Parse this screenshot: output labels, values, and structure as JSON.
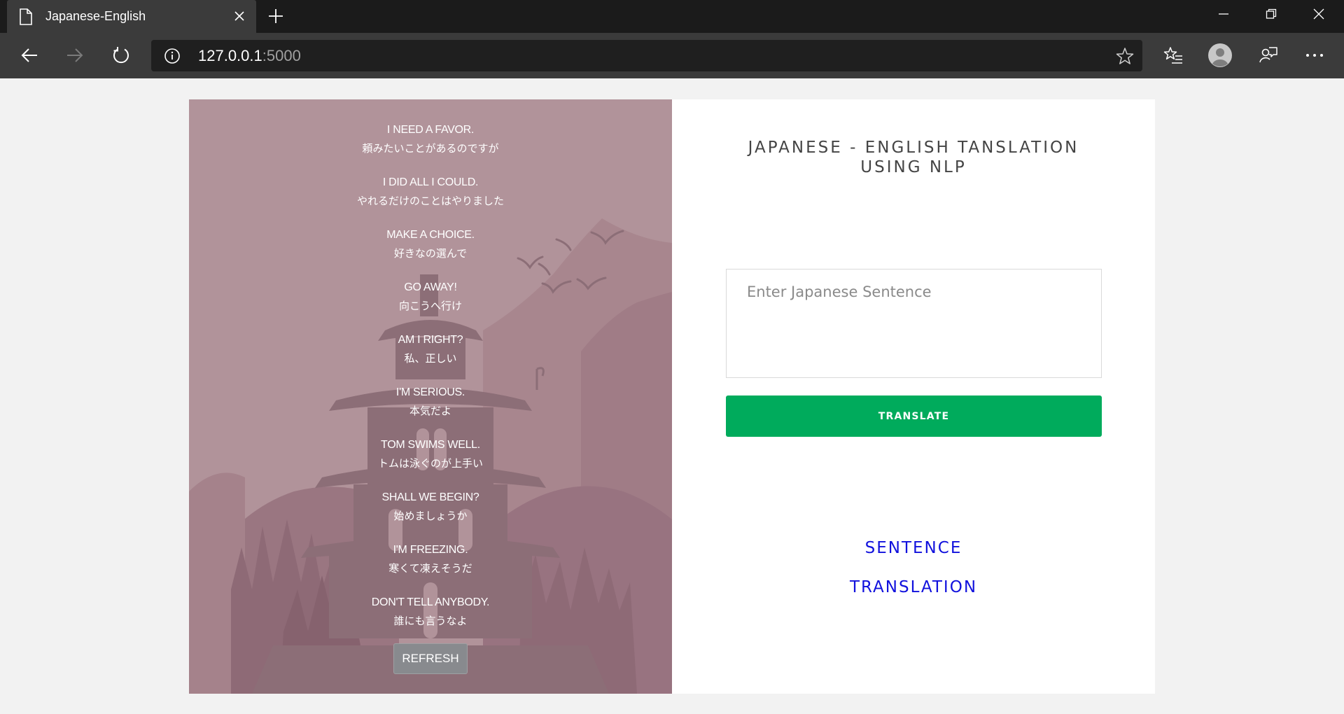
{
  "browser": {
    "tab_title": "Japanese-English",
    "url_host": "127.0.0.1",
    "url_port": ":5000"
  },
  "phrases": [
    {
      "en": "I NEED A FAVOR.",
      "ja": "頼みたいことがあるのですが"
    },
    {
      "en": "I DID ALL I COULD.",
      "ja": "やれるだけのことはやりました"
    },
    {
      "en": "MAKE A CHOICE.",
      "ja": "好きなの選んで"
    },
    {
      "en": "GO AWAY!",
      "ja": "向こうへ行け"
    },
    {
      "en": "AM I RIGHT?",
      "ja": "私、正しい"
    },
    {
      "en": "I'M SERIOUS.",
      "ja": "本気だよ"
    },
    {
      "en": "TOM SWIMS WELL.",
      "ja": "トムは泳ぐのが上手い"
    },
    {
      "en": "SHALL WE BEGIN?",
      "ja": "始めましょうか"
    },
    {
      "en": "I'M FREEZING.",
      "ja": "寒くて凍えそうだ"
    },
    {
      "en": "DON'T TELL ANYBODY.",
      "ja": "誰にも言うなよ"
    }
  ],
  "refresh_label": "REFRESH",
  "app": {
    "title_line1": "JAPANESE - ENGLISH TANSLATION",
    "title_line2": "USING NLP",
    "input_placeholder": "Enter Japanese Sentence",
    "translate_label": "TRANSLATE",
    "sentence_label": "SENTENCE",
    "translation_label": "TRANSLATION"
  },
  "colors": {
    "translate_button": "#00ab5c",
    "left_panel": "#b1939a",
    "result_text": "#1111dd"
  }
}
